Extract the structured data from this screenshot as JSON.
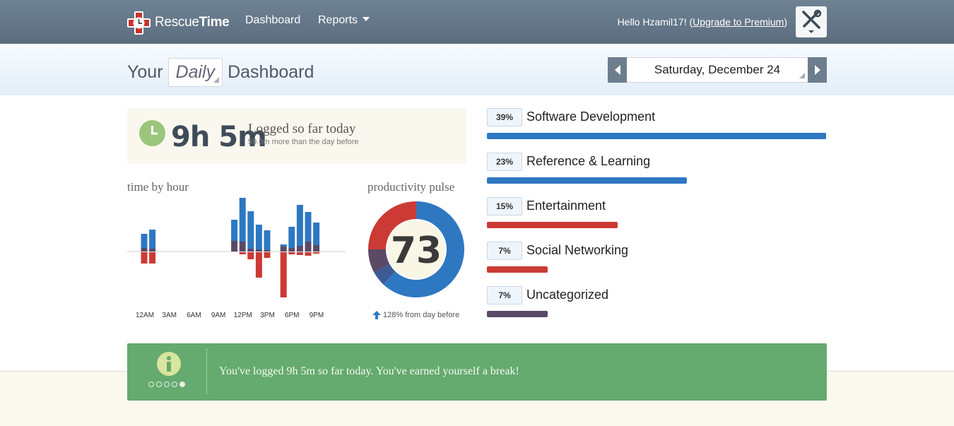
{
  "header": {
    "logo_light": "Rescue",
    "logo_bold": "Time",
    "nav": [
      {
        "label": "Dashboard"
      },
      {
        "label": "Reports"
      }
    ],
    "greeting": "Hello Hzamil17! (",
    "upgrade_link": "Upgrade to Premium",
    "greeting_end": ")"
  },
  "subheader": {
    "title_prefix": "Your",
    "period": "Daily",
    "title_suffix": "Dashboard",
    "date": "Saturday, December 24"
  },
  "summary": {
    "logged_time": "9h 5m",
    "logged_label": "Logged so far today",
    "comparison": "59.6m more than the day before"
  },
  "time_by_hour": {
    "title": "time by hour",
    "tick_labels": [
      "12AM",
      "3AM",
      "6AM",
      "9AM",
      "12PM",
      "3PM",
      "6PM",
      "9PM"
    ]
  },
  "productivity_pulse": {
    "title": "productivity pulse",
    "score": "73",
    "change": "128% from day before"
  },
  "chart_data": [
    {
      "type": "bar",
      "title": "time by hour",
      "categories": [
        "12AM",
        "1AM",
        "2AM",
        "3AM",
        "4AM",
        "5AM",
        "6AM",
        "7AM",
        "8AM",
        "9AM",
        "10AM",
        "11AM",
        "12PM",
        "1PM",
        "2PM",
        "3PM",
        "4PM",
        "5PM",
        "6PM",
        "7PM",
        "8PM",
        "9PM",
        "10PM",
        "11PM"
      ],
      "series": [
        {
          "color": "#2e78c2",
          "values": [
            20,
            27,
            0,
            0,
            0,
            0,
            0,
            0,
            0,
            0,
            0,
            30,
            62,
            53,
            35,
            28,
            0,
            3,
            30,
            58,
            42,
            32,
            0,
            0
          ]
        },
        {
          "color": "#5a4a66",
          "values": [
            5,
            4,
            0,
            0,
            0,
            0,
            0,
            0,
            0,
            0,
            0,
            15,
            14,
            4,
            3,
            2,
            0,
            7,
            5,
            8,
            14,
            9,
            0,
            0
          ]
        },
        {
          "color": "#cc3a35",
          "values": [
            -16,
            -16,
            0,
            0,
            0,
            0,
            0,
            0,
            0,
            0,
            0,
            0,
            -3,
            -10,
            -36,
            -8,
            0,
            -64,
            -3,
            -4,
            -5,
            -2,
            0,
            0
          ]
        }
      ],
      "xlabel": "",
      "ylabel": ""
    },
    {
      "type": "pie",
      "title": "productivity pulse",
      "series": [
        {
          "color": "#2e78c2",
          "value": 62
        },
        {
          "color": "#3e5a93",
          "value": 5
        },
        {
          "color": "#5a4a66",
          "value": 8
        },
        {
          "color": "#cc3a35",
          "value": 25
        }
      ]
    }
  ],
  "categories": [
    {
      "percent": "39%",
      "label": "Software Development",
      "color": "#2e78c2",
      "share": 0.39
    },
    {
      "percent": "23%",
      "label": "Reference & Learning",
      "color": "#2e78c2",
      "share": 0.23
    },
    {
      "percent": "15%",
      "label": "Entertainment",
      "color": "#cc3a35",
      "share": 0.15
    },
    {
      "percent": "7%",
      "label": "Social Networking",
      "color": "#cc3a35",
      "share": 0.07
    },
    {
      "percent": "7%",
      "label": "Uncategorized",
      "color": "#5a4a66",
      "share": 0.07
    }
  ],
  "banner": {
    "message": "You've logged 9h 5m so far today. You've earned yourself a break!",
    "dots": [
      false,
      false,
      false,
      false,
      true
    ]
  }
}
